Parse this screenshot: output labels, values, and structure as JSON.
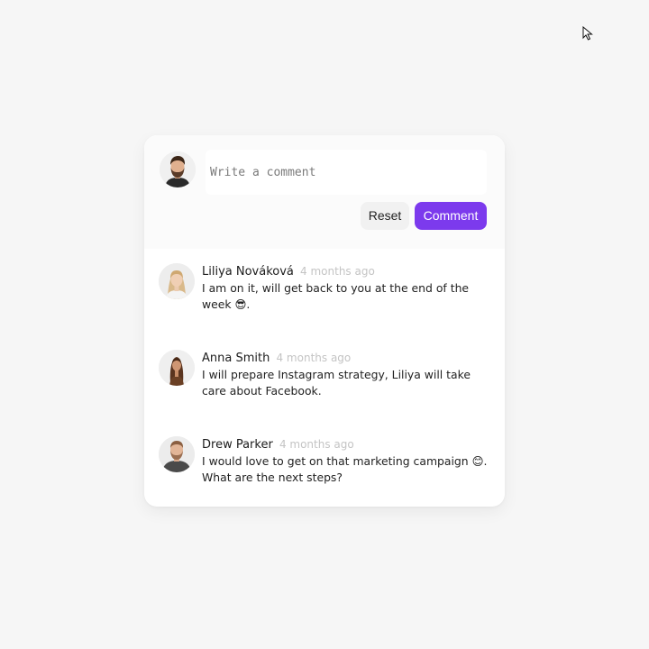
{
  "composer": {
    "placeholder": "Write a comment",
    "reset_label": "Reset",
    "comment_label": "Comment",
    "current_user_avatar": "user-avatar-man-beard"
  },
  "comments": [
    {
      "author": "Liliya Nováková",
      "time": "4 months ago",
      "text": "I am on it, will get back to you at the end of the week 😎.",
      "avatar": "avatar-liliya"
    },
    {
      "author": "Anna Smith",
      "time": "4 months ago",
      "text": "I will prepare Instagram strategy, Liliya will take care about Facebook.",
      "avatar": "avatar-anna"
    },
    {
      "author": "Drew Parker",
      "time": "4 months ago",
      "text": "I would love to get on that marketing campaign 😊. What are the next steps?",
      "avatar": "avatar-drew"
    }
  ],
  "colors": {
    "accent": "#7c3aed",
    "background": "#f6f6f6",
    "card": "#ffffff",
    "timestamp": "#c4c4c4"
  }
}
